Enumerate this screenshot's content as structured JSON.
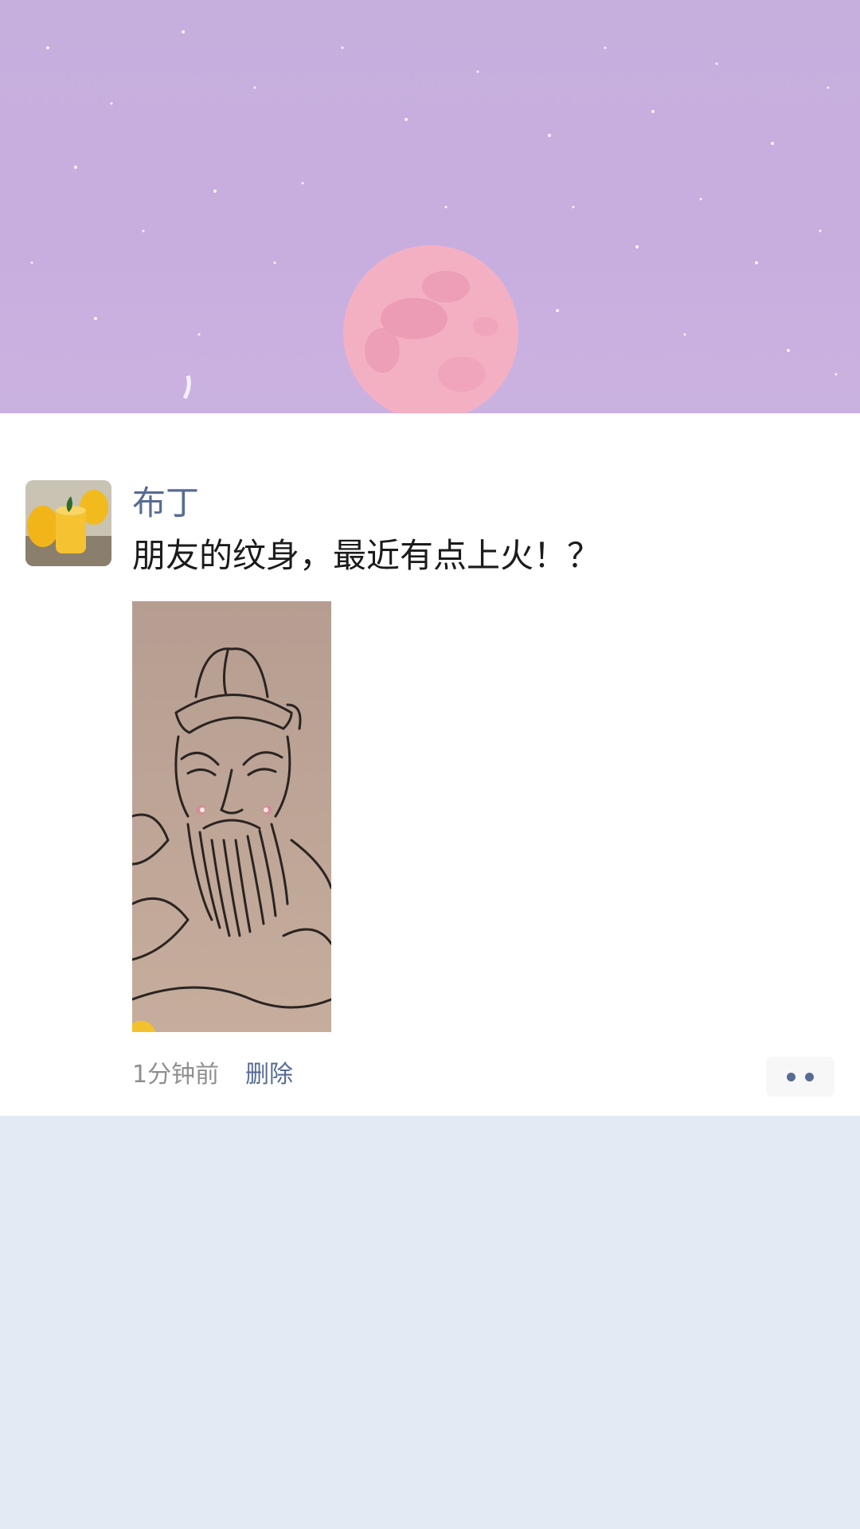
{
  "post": {
    "username": "布丁",
    "text": "朋友的纹身，最近有点上火！？",
    "time": "1分钟前",
    "delete_label": "删除"
  },
  "colors": {
    "name_link": "#576b95",
    "sky": "#c8aedf",
    "moon": "#f4b0c3",
    "feed_background": "#e2ebf3"
  },
  "icons": {
    "more": "more-dots-icon"
  }
}
